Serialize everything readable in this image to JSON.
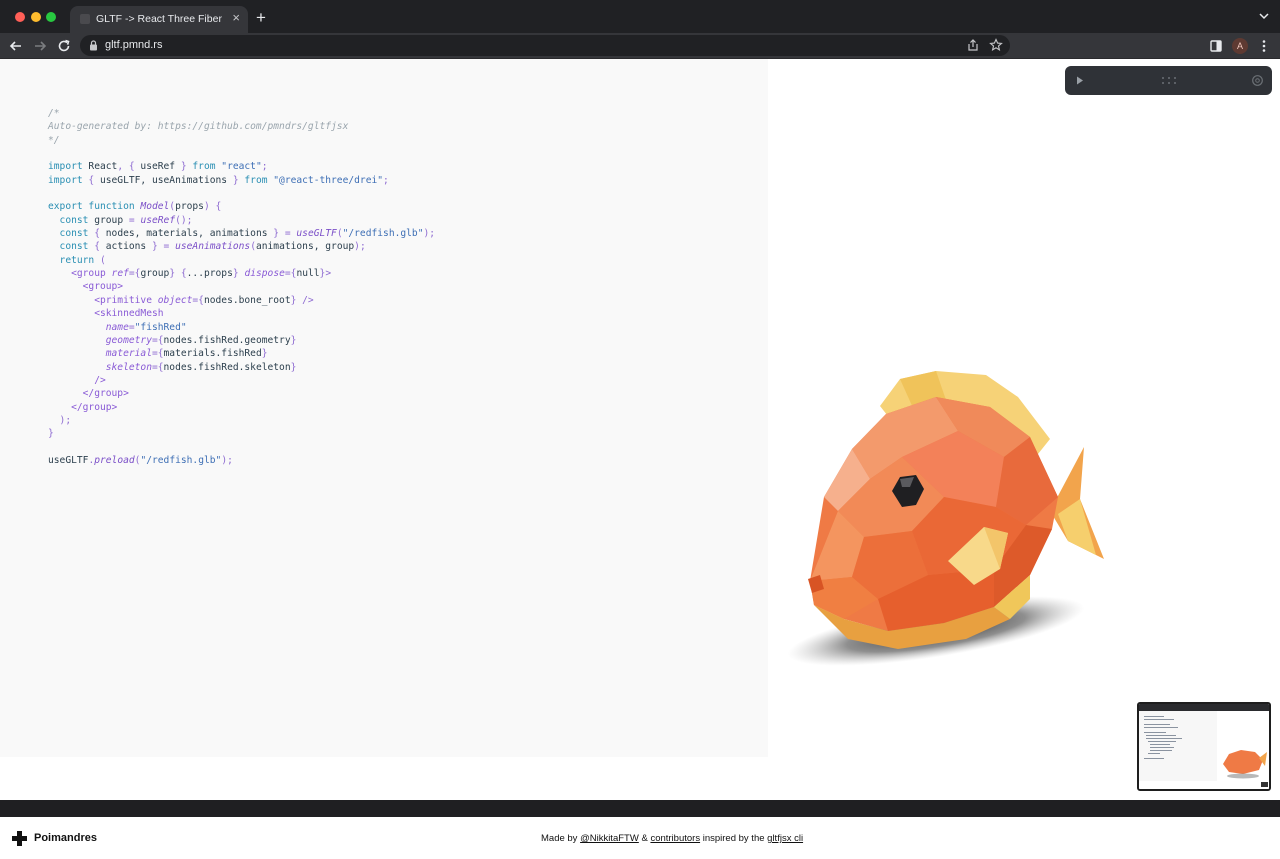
{
  "browser": {
    "tab_title": "GLTF -> React Three Fiber",
    "tab_close": "×",
    "new_tab": "+",
    "url": "gltf.pmnd.rs",
    "avatar_initial": "A"
  },
  "code": {
    "lines": [
      [
        [
          "cm",
          "/*"
        ]
      ],
      [
        [
          "cm",
          "Auto-generated by: https://github.com/pmndrs/gltfjsx"
        ]
      ],
      [
        [
          "cm",
          "*/"
        ]
      ],
      [],
      [
        [
          "kw",
          "import"
        ],
        [
          "pl",
          " React"
        ],
        [
          "pu",
          ", { "
        ],
        [
          "pl",
          "useRef"
        ],
        [
          "pu",
          " } "
        ],
        [
          "kw",
          "from"
        ],
        [
          "str",
          " \"react\""
        ],
        [
          "pu",
          ";"
        ]
      ],
      [
        [
          "kw",
          "import"
        ],
        [
          "pu",
          " { "
        ],
        [
          "pl",
          "useGLTF, useAnimations"
        ],
        [
          "pu",
          " } "
        ],
        [
          "kw",
          "from"
        ],
        [
          "str",
          " \"@react-three/drei\""
        ],
        [
          "pu",
          ";"
        ]
      ],
      [],
      [
        [
          "kw",
          "export function"
        ],
        [
          "fn",
          " Model"
        ],
        [
          "pu",
          "("
        ],
        [
          "pl",
          "props"
        ],
        [
          "pu",
          ") {"
        ]
      ],
      [
        [
          "kw",
          "  const"
        ],
        [
          "pl",
          " group "
        ],
        [
          "pu",
          "= "
        ],
        [
          "fn",
          "useRef"
        ],
        [
          "pu",
          "();"
        ]
      ],
      [
        [
          "kw",
          "  const"
        ],
        [
          "pu",
          " { "
        ],
        [
          "pl",
          "nodes, materials, animations"
        ],
        [
          "pu",
          " } = "
        ],
        [
          "fn",
          "useGLTF"
        ],
        [
          "pu",
          "("
        ],
        [
          "str",
          "\"/redfish.glb\""
        ],
        [
          "pu",
          ");"
        ]
      ],
      [
        [
          "kw",
          "  const"
        ],
        [
          "pu",
          " { "
        ],
        [
          "pl",
          "actions"
        ],
        [
          "pu",
          " } = "
        ],
        [
          "fn",
          "useAnimations"
        ],
        [
          "pu",
          "("
        ],
        [
          "pl",
          "animations, group"
        ],
        [
          "pu",
          ");"
        ]
      ],
      [
        [
          "kw",
          "  return"
        ],
        [
          "pu",
          " ("
        ]
      ],
      [
        [
          "tag",
          "    <group"
        ],
        [
          "attr",
          " ref"
        ],
        [
          "pu",
          "={"
        ],
        [
          "pl",
          "group"
        ],
        [
          "pu",
          "} {"
        ],
        [
          "pl",
          "...props"
        ],
        [
          "pu",
          "} "
        ],
        [
          "attr",
          "dispose"
        ],
        [
          "pu",
          "={"
        ],
        [
          "pl",
          "null"
        ],
        [
          "pu",
          "}>"
        ]
      ],
      [
        [
          "tag",
          "      <group>"
        ]
      ],
      [
        [
          "tag",
          "        <primitive"
        ],
        [
          "attr",
          " object"
        ],
        [
          "pu",
          "={"
        ],
        [
          "pl",
          "nodes.bone_root"
        ],
        [
          "pu",
          "} />"
        ]
      ],
      [
        [
          "tag",
          "        <skinnedMesh"
        ]
      ],
      [
        [
          "attr",
          "          name"
        ],
        [
          "pu",
          "="
        ],
        [
          "str",
          "\"fishRed\""
        ]
      ],
      [
        [
          "attr",
          "          geometry"
        ],
        [
          "pu",
          "={"
        ],
        [
          "pl",
          "nodes.fishRed.geometry"
        ],
        [
          "pu",
          "}"
        ]
      ],
      [
        [
          "attr",
          "          material"
        ],
        [
          "pu",
          "={"
        ],
        [
          "pl",
          "materials.fishRed"
        ],
        [
          "pu",
          "}"
        ]
      ],
      [
        [
          "attr",
          "          skeleton"
        ],
        [
          "pu",
          "={"
        ],
        [
          "pl",
          "nodes.fishRed.skeleton"
        ],
        [
          "pu",
          "}"
        ]
      ],
      [
        [
          "tag",
          "        />"
        ]
      ],
      [
        [
          "tag",
          "      </group>"
        ]
      ],
      [
        [
          "tag",
          "    </group>"
        ]
      ],
      [
        [
          "pu",
          "  );"
        ]
      ],
      [
        [
          "pu",
          "}"
        ]
      ],
      [],
      [
        [
          "pl",
          "useGLTF"
        ],
        [
          "pu",
          "."
        ],
        [
          "fn",
          "preload"
        ],
        [
          "pu",
          "("
        ],
        [
          "str",
          "\"/redfish.glb\""
        ],
        [
          "pu",
          ");"
        ]
      ]
    ]
  },
  "footer": {
    "brand": "Poimandres",
    "made_by": "Made by",
    "author": "@NikkitaFTW",
    "amp": "&",
    "contributors": "contributors",
    "inspired": "inspired by the",
    "cli": "gltfjsx cli"
  },
  "icons": {
    "lock": "lock-icon",
    "share": "share-icon",
    "star": "bookmark-star-icon",
    "sidebar": "side-panel-icon",
    "menu": "kebab-menu-icon",
    "play": "play-icon",
    "grip": "drag-grip-icon",
    "search": "search-icon",
    "brand": "poimandres-logo-icon"
  },
  "colors": {
    "accent_keyword": "#2a8fb3",
    "accent_string": "#3e6fb5",
    "accent_tag": "#8a5bd6",
    "fish_orange": "#ef7a45"
  }
}
